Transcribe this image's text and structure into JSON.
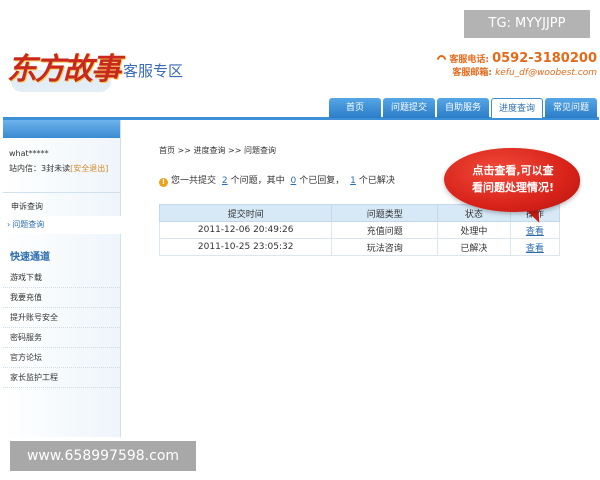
{
  "watermarks": {
    "top": "TG: MYYJJPP",
    "bottom": "www.658997598.com"
  },
  "logo": {
    "brand": "东方故事",
    "subtitle": "客服专区"
  },
  "contact": {
    "phone_label": "客服电话:",
    "phone": "0592-3180200",
    "email_label": "客服邮箱:",
    "email": "kefu_df@woobest.com"
  },
  "nav": {
    "tabs": [
      {
        "label": "首页"
      },
      {
        "label": "问题提交"
      },
      {
        "label": "自助服务"
      },
      {
        "label": "进度查询",
        "active": true
      },
      {
        "label": "常见问题"
      }
    ]
  },
  "user": {
    "name": "what*****",
    "msg_prefix": "站内信：3封未读",
    "logout": "[安全退出]"
  },
  "sidebar": {
    "menu": [
      {
        "label": "申诉查询"
      },
      {
        "label": "问题查询",
        "active": true
      }
    ],
    "quick_title": "快速通道",
    "quick_links": [
      {
        "label": "游戏下载"
      },
      {
        "label": "我要充值"
      },
      {
        "label": "提升账号安全"
      },
      {
        "label": "密码服务"
      },
      {
        "label": "官方论坛"
      },
      {
        "label": "家长监护工程"
      }
    ]
  },
  "breadcrumb": "首页 >> 进度查询 >> 问题查询",
  "summary": {
    "p1": "您一共提交",
    "total": "2",
    "p2": "个问题，其中",
    "replied": "0",
    "p3": "个已回复，",
    "solved": "1",
    "p4": "个已解决"
  },
  "table": {
    "headers": [
      "提交时间",
      "问题类型",
      "状态",
      "操作"
    ],
    "rows": [
      {
        "time": "2011-12-06 20:49:26",
        "type": "充值问题",
        "status": "处理中",
        "action": "查看"
      },
      {
        "time": "2011-10-25 23:05:32",
        "type": "玩法咨询",
        "status": "已解决",
        "action": "查看"
      }
    ]
  },
  "callout": {
    "line1": "点击查看,可以查",
    "line2": "看问题处理情况!"
  },
  "colors": {
    "accent": "#3d8fd6",
    "link": "#2b6db0",
    "orange": "#e46a1a",
    "bubble": "#d8231a"
  }
}
